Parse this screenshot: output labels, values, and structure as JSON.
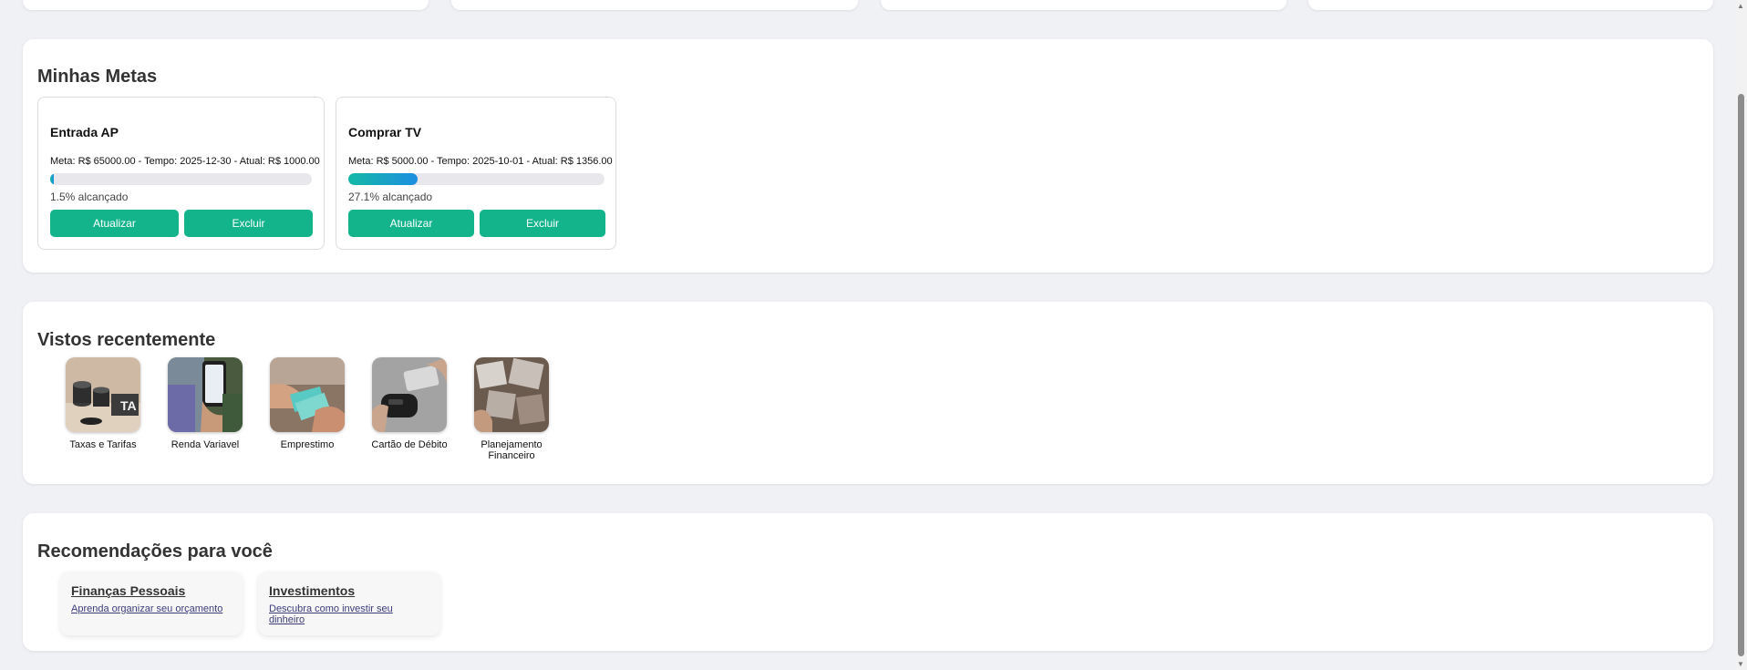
{
  "goals_section": {
    "title": "Minhas Metas",
    "goals": [
      {
        "title": "Entrada AP",
        "meta_line": "Meta: R$ 65000.00 - Tempo: 2025-12-30 - Atual: R$ 1000.00",
        "progress_text": "1.5% alcançado",
        "progress": 0.015,
        "update_label": "Atualizar",
        "delete_label": "Excluir"
      },
      {
        "title": "Comprar TV",
        "meta_line": "Meta: R$ 5000.00 - Tempo: 2025-10-01 - Atual: R$ 1356.00",
        "progress_text": "27.1% alcançado",
        "progress": 0.271,
        "update_label": "Atualizar",
        "delete_label": "Excluir"
      }
    ]
  },
  "recent_section": {
    "title": "Vistos recentemente",
    "items": [
      {
        "label": "Taxas e Tarifas",
        "icon": "coins-tax-image"
      },
      {
        "label": "Renda Variavel",
        "icon": "phone-investing-image"
      },
      {
        "label": "Emprestimo",
        "icon": "cash-handoff-image"
      },
      {
        "label": "Cartão de Débito",
        "icon": "card-terminal-image"
      },
      {
        "label": "Planejamento Financeiro",
        "icon": "planning-papers-image"
      }
    ]
  },
  "recommend_section": {
    "title": "Recomendações para você",
    "cards": [
      {
        "title": "Finanças Pessoais",
        "description": "Aprenda organizar seu orçamento"
      },
      {
        "title": "Investimentos",
        "description": "Descubra como investir seu dinheiro"
      }
    ]
  },
  "colors": {
    "accent": "#13b38b",
    "progress_start": "#14b8a6",
    "progress_end": "#1d8fe0",
    "background": "#f0f1f5"
  }
}
